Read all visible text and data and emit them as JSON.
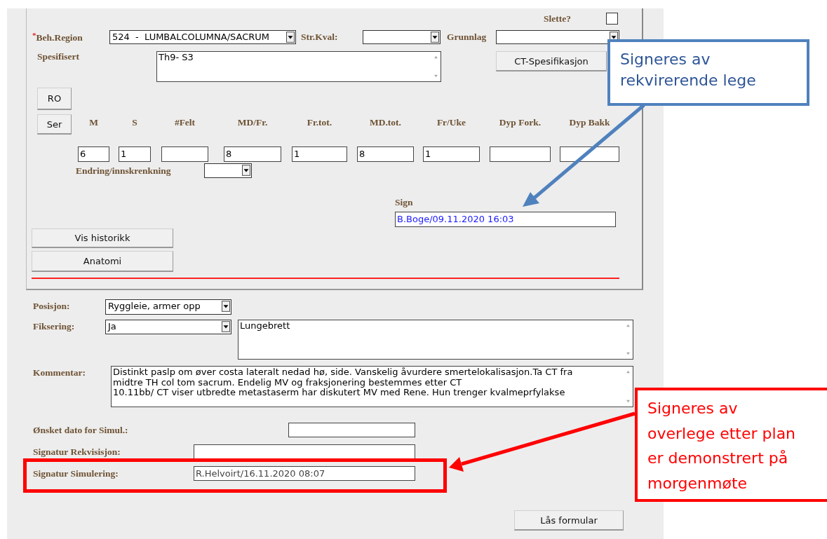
{
  "delete_toggle": {
    "label": "Slette?",
    "checked": false
  },
  "region": {
    "required_mark": "*",
    "label": "Beh.Region",
    "value": "524  -  LUMBALCOLUMNA/SACRUM"
  },
  "str_kval": {
    "label": "Str.Kval:"
  },
  "grunnlag": {
    "label": "Grunnlag"
  },
  "spesifisert": {
    "label": "Spesifisert",
    "value": "Th9- S3"
  },
  "ct_button": "CT-Spesifikasjon",
  "side_buttons": [
    "RO",
    "Ser"
  ],
  "dose_columns": [
    {
      "label": "M",
      "value": "6"
    },
    {
      "label": "S",
      "value": "1"
    },
    {
      "label": "#Felt"
    },
    {
      "label": "MD/Fr.",
      "value": "8"
    },
    {
      "label": "Fr.tot.",
      "value": "1"
    },
    {
      "label": "MD.tot.",
      "value": "8"
    },
    {
      "label": "Fr/Uke",
      "value": "1"
    },
    {
      "label": "Dyp Fork."
    },
    {
      "label": "Dyp Bakk"
    }
  ],
  "endring": {
    "label": "Endring/innskrenkning"
  },
  "sign": {
    "label": "Sign",
    "value": "B.Boge/09.11.2020 16:03"
  },
  "panel_buttons": [
    "Vis historikk",
    "Anatomi"
  ],
  "posisjon": {
    "label": "Posisjon:",
    "value": "Ryggleie, armer opp"
  },
  "fiksering": {
    "label": "Fiksering:",
    "value": "Ja",
    "note": "Lungebrett"
  },
  "kommentar": {
    "label": "Kommentar:",
    "lines": [
      "Distinkt paslp om øver costa lateralt nedad hø, side. Vanskelig åvurdere smertelokalisasjon.Ta CT fra",
      "midtre TH col tom sacrum. Endelig MV og fraksjonering bestemmes etter CT",
      "10.11bb/ CT viser utbredte metastaserm har diskutert MV med Rene. Hun trenger kvalmeprfylakse"
    ]
  },
  "signatures": [
    {
      "label": "Ønsket dato for Simul.:",
      "highlighted": false
    },
    {
      "label": "Signatur Rekvisisjon:",
      "highlighted": false
    },
    {
      "label": "Signatur Simulering:",
      "value": "R.Helvoirt/16.11.2020 08:07",
      "highlighted": true
    }
  ],
  "lock_button": "Lås formular",
  "callouts": [
    {
      "kind": "blue",
      "lines": [
        "Signeres av",
        "rekvirerende lege"
      ]
    },
    {
      "kind": "red",
      "lines": [
        "Signeres av",
        "overlege etter plan",
        "er demonstrert på",
        "morgenmøte"
      ]
    }
  ]
}
